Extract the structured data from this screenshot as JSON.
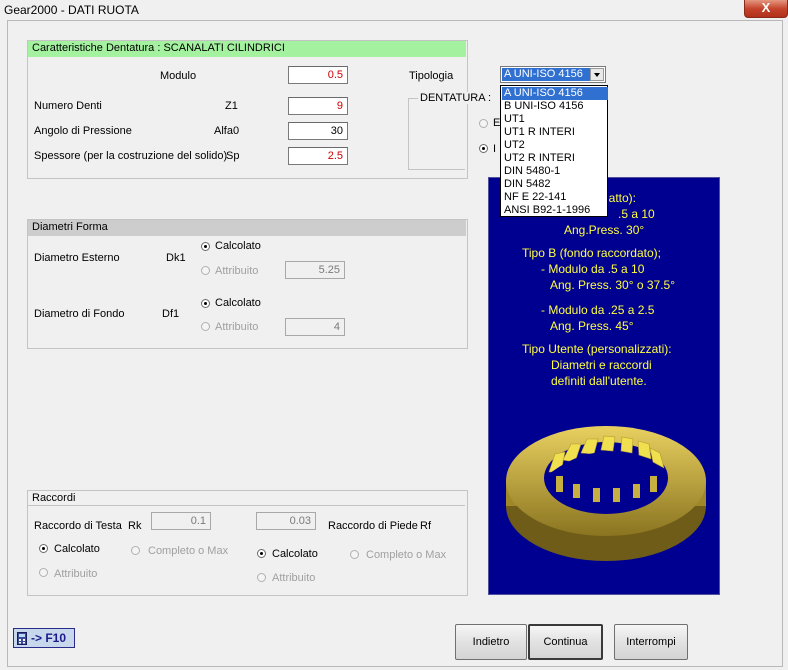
{
  "window": {
    "title": "Gear2000 - DATI RUOTA",
    "close_glyph": "X"
  },
  "caratteristiche": {
    "header": "Caratteristiche Dentatura : SCANALATI CILINDRICI",
    "modulo_label": "Modulo",
    "modulo_value": "0.5",
    "numero_denti_label": "Numero Denti",
    "numero_denti_sym": "Z1",
    "numero_denti_value": "9",
    "angolo_label": "Angolo di Pressione",
    "angolo_sym": "Alfa0",
    "angolo_value": "30",
    "spessore_label": "Spessore (per la costruzione del solido)",
    "spessore_sym": "Sp",
    "spessore_value": "2.5",
    "tipologia_label": "Tipologia",
    "tipologia_selected": "A UNI-ISO 4156",
    "tipologia_options": [
      "A UNI-ISO 4156",
      "B UNI-ISO 4156",
      "UT1",
      "UT1 R INTERI",
      "UT2",
      "UT2 R INTERI",
      "DIN 5480-1",
      "DIN 5482",
      "NF E 22-141",
      "ANSI B92-1-1996"
    ],
    "dentatura_label": "DENTATURA :",
    "dentatura_opt1": "E",
    "dentatura_opt2": "I"
  },
  "diametri": {
    "header": "Diametri Forma",
    "esterno_label": "Diametro Esterno",
    "esterno_sym": "Dk1",
    "fondo_label": "Diametro di Fondo",
    "fondo_sym": "Df1",
    "calcolato": "Calcolato",
    "attribuito": "Attribuito",
    "esterno_value": "5.25",
    "fondo_value": "4"
  },
  "info": {
    "lines": [
      "iatto):",
      ".5 a 10",
      "Ang.Press. 30°",
      "Tipo B (fondo raccordato);",
      "- Modulo da .5 a 10",
      "Ang. Press. 30° o 37.5°",
      "- Modulo da .25 a 2.5",
      "Ang. Press. 45°",
      "Tipo Utente (personalizzati):",
      "Diametri e raccordi",
      "definiti dall'utente."
    ]
  },
  "raccordi": {
    "header": "Raccordi",
    "testa_label": "Raccordo di Testa",
    "testa_sym": "Rk",
    "testa_value": "0.1",
    "piede_label": "Raccordo di Piede",
    "piede_sym": "Rf",
    "piede_value": "0.03",
    "calcolato": "Calcolato",
    "completo": "Completo o Max",
    "attribuito": "Attribuito"
  },
  "footer": {
    "f10_label": "-> F10",
    "indietro": "Indietro",
    "continua": "Continua",
    "interrompi": "Interrompi"
  },
  "colors": {
    "accent_green": "#a4f2a0",
    "info_bg": "#000090",
    "info_text": "#ffff40",
    "gear": "#c8b040"
  }
}
